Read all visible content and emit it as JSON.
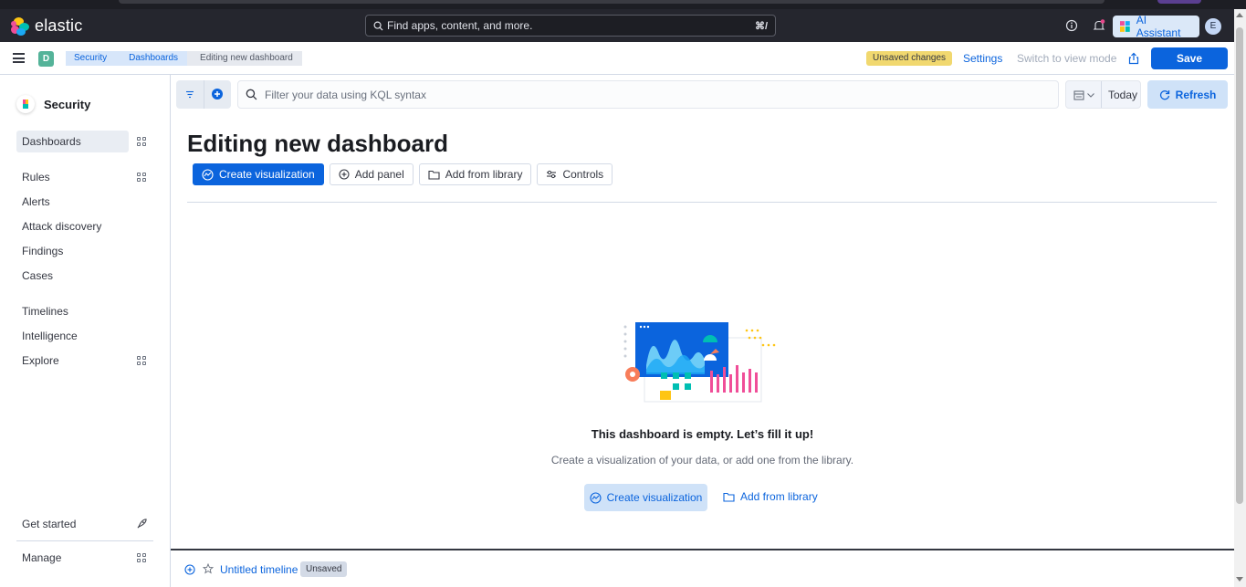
{
  "header": {
    "brand": "elastic",
    "search_placeholder": "Find apps, content, and more.",
    "search_shortcut": "⌘/",
    "ai_assistant_label": "AI Assistant",
    "avatar_initial": "E"
  },
  "subbar": {
    "space_initial": "D",
    "breadcrumbs": [
      "Security",
      "Dashboards",
      "Editing new dashboard"
    ],
    "unsaved_badge": "Unsaved changes",
    "settings_label": "Settings",
    "switch_mode_label": "Switch to view mode",
    "save_label": "Save"
  },
  "sidebar": {
    "title": "Security",
    "items": [
      {
        "label": "Dashboards"
      },
      {
        "label": "Rules"
      },
      {
        "label": "Alerts"
      },
      {
        "label": "Attack discovery"
      },
      {
        "label": "Findings"
      },
      {
        "label": "Cases"
      },
      {
        "label": "Timelines"
      },
      {
        "label": "Intelligence"
      },
      {
        "label": "Explore"
      },
      {
        "label": "Get started"
      },
      {
        "label": "Manage"
      }
    ]
  },
  "query": {
    "placeholder": "Filter your data using KQL syntax",
    "date_label": "Today",
    "refresh_label": "Refresh"
  },
  "main": {
    "title": "Editing new dashboard",
    "toolbar": {
      "create_visualization": "Create visualization",
      "add_panel": "Add panel",
      "add_from_library": "Add from library",
      "controls": "Controls"
    },
    "empty": {
      "title": "This dashboard is empty. Let’s fill it up!",
      "description": "Create a visualization of your data, or add one from the library.",
      "create_visualization": "Create visualization",
      "add_from_library": "Add from library"
    }
  },
  "timeline": {
    "name": "Untitled timeline",
    "badge": "Unsaved"
  },
  "colors": {
    "primary": "#0b64dd",
    "header_bg": "#25262e",
    "unsaved_badge": "#f1d86f",
    "space_badge": "#54b399"
  }
}
